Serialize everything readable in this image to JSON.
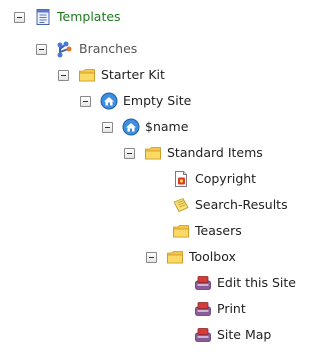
{
  "tree": {
    "items": [
      {
        "label": "Templates",
        "icon": "templates-icon"
      },
      {
        "label": "Branches",
        "icon": "branches-icon"
      },
      {
        "label": "Starter Kit",
        "icon": "folder-icon"
      },
      {
        "label": "Empty Site",
        "icon": "home-icon"
      },
      {
        "label": "$name",
        "icon": "home-icon"
      },
      {
        "label": "Standard Items",
        "icon": "folder-icon"
      },
      {
        "label": "Copyright",
        "icon": "copyright-document-icon"
      },
      {
        "label": "Search-Results",
        "icon": "search-results-icon"
      },
      {
        "label": "Teasers",
        "icon": "folder-icon"
      },
      {
        "label": "Toolbox",
        "icon": "folder-icon"
      },
      {
        "label": "Edit this Site",
        "icon": "toolbox-item-icon"
      },
      {
        "label": "Print",
        "icon": "toolbox-item-icon"
      },
      {
        "label": "Site Map",
        "icon": "toolbox-item-icon"
      }
    ]
  }
}
